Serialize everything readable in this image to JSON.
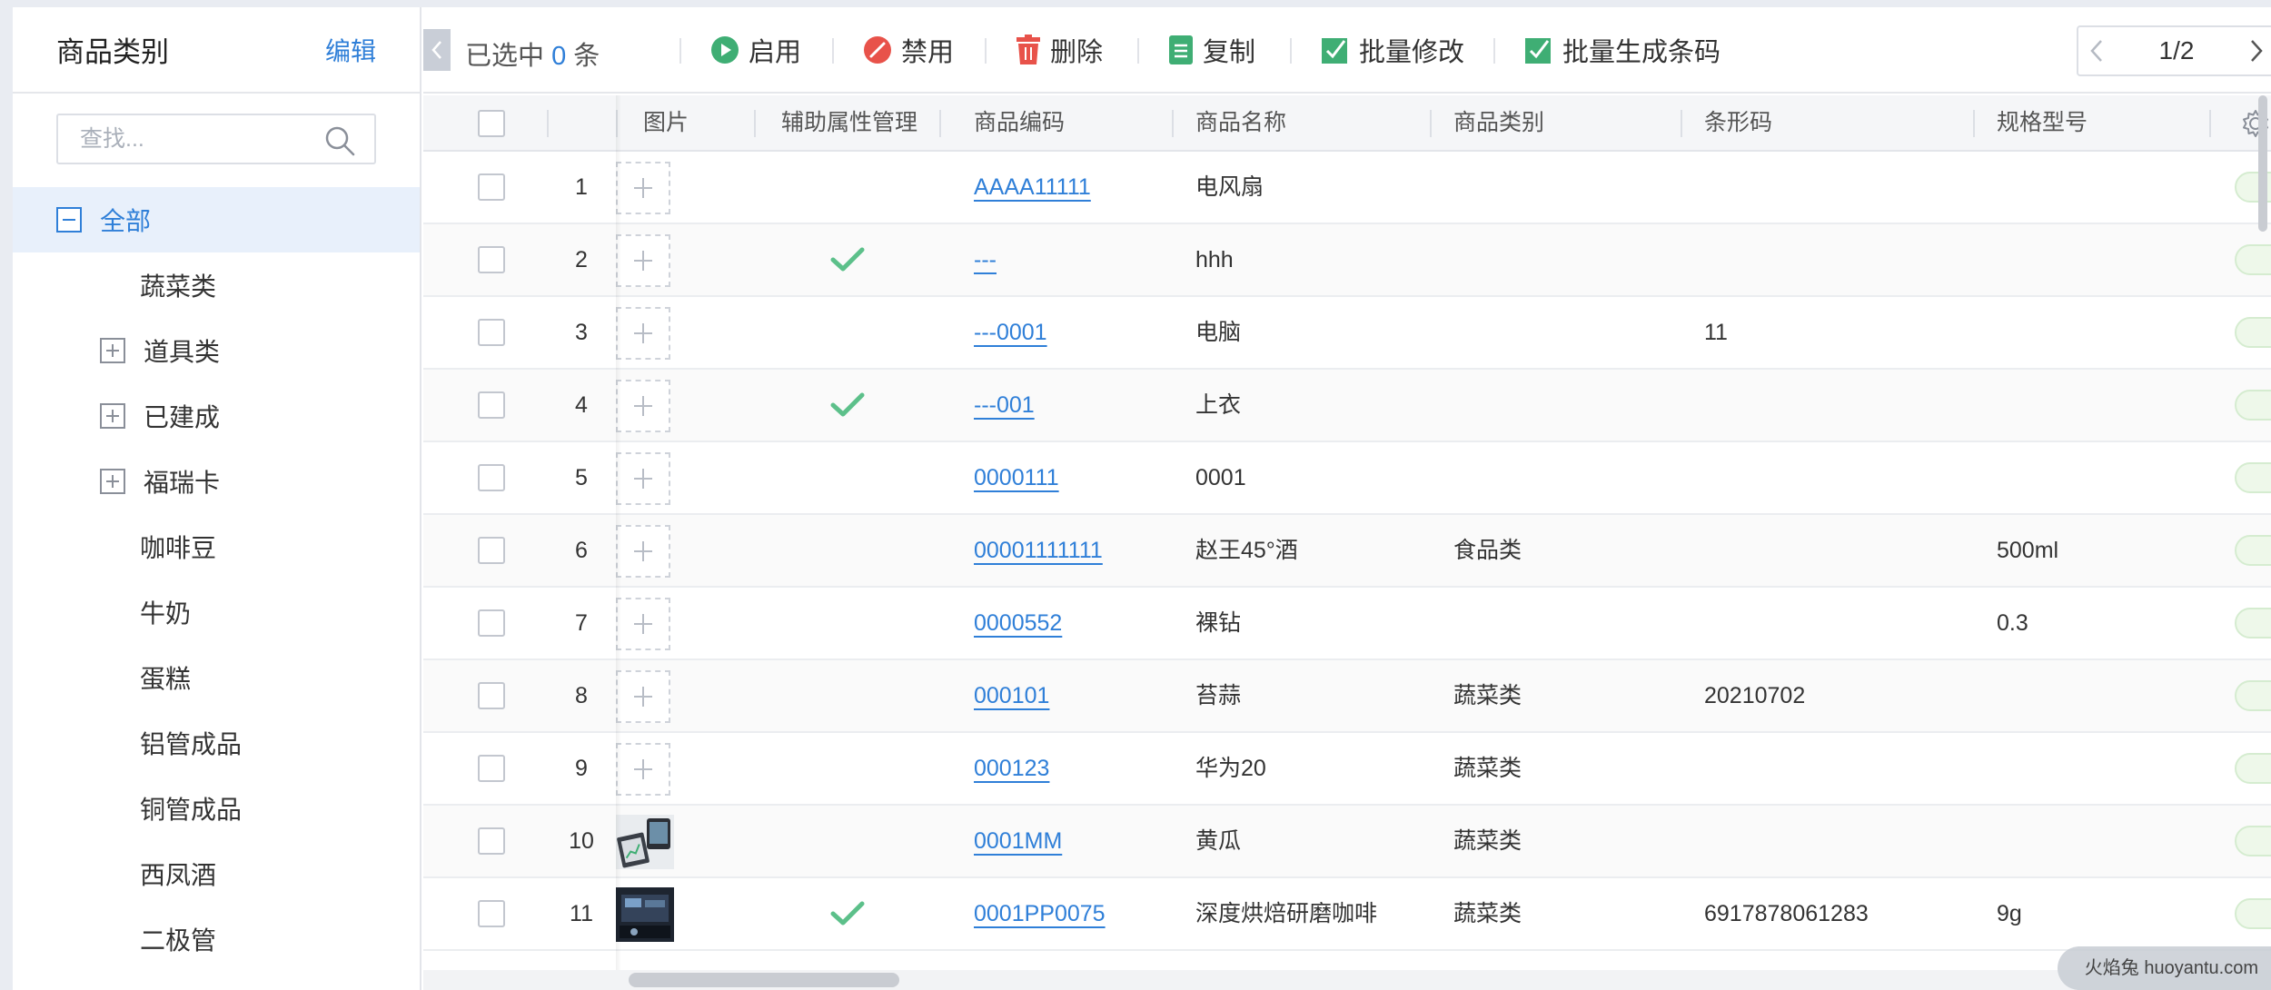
{
  "sidebar": {
    "title": "商品类别",
    "edit_label": "编辑",
    "search_placeholder": "查找...",
    "tree": [
      {
        "label": "全部",
        "level": 0,
        "toggle": "minus",
        "active": true
      },
      {
        "label": "蔬菜类",
        "level": 1,
        "toggle": "none"
      },
      {
        "label": "道具类",
        "level": 1,
        "toggle": "plus"
      },
      {
        "label": "已建成",
        "level": 1,
        "toggle": "plus"
      },
      {
        "label": "福瑞卡",
        "level": 1,
        "toggle": "plus"
      },
      {
        "label": "咖啡豆",
        "level": 1,
        "toggle": "none"
      },
      {
        "label": "牛奶",
        "level": 1,
        "toggle": "none"
      },
      {
        "label": "蛋糕",
        "level": 1,
        "toggle": "none"
      },
      {
        "label": "铝管成品",
        "level": 1,
        "toggle": "none"
      },
      {
        "label": "铜管成品",
        "level": 1,
        "toggle": "none"
      },
      {
        "label": "西凤酒",
        "level": 1,
        "toggle": "none"
      },
      {
        "label": "二极管",
        "level": 1,
        "toggle": "none"
      }
    ]
  },
  "toolbar": {
    "selected_prefix": "已选中",
    "selected_count": "0",
    "selected_suffix": "条",
    "enable_label": "启用",
    "disable_label": "禁用",
    "delete_label": "删除",
    "copy_label": "复制",
    "batch_edit_label": "批量修改",
    "batch_barcode_label": "批量生成条码",
    "pager_text": "1/2"
  },
  "table": {
    "headers": {
      "image": "图片",
      "aux_attr": "辅助属性管理",
      "code": "商品编码",
      "name": "商品名称",
      "category": "商品类别",
      "barcode": "条形码",
      "spec": "规格型号"
    },
    "rows": [
      {
        "no": "1",
        "image": "placeholder",
        "aux": false,
        "code": "AAAA11111",
        "name": "电风扇",
        "category": "",
        "barcode": "",
        "spec": ""
      },
      {
        "no": "2",
        "image": "placeholder",
        "aux": true,
        "code": "---",
        "name": "hhh",
        "category": "",
        "barcode": "",
        "spec": ""
      },
      {
        "no": "3",
        "image": "placeholder",
        "aux": false,
        "code": "---0001",
        "name": "电脑",
        "category": "",
        "barcode": "11",
        "spec": ""
      },
      {
        "no": "4",
        "image": "placeholder",
        "aux": true,
        "code": "---001",
        "name": "上衣",
        "category": "",
        "barcode": "",
        "spec": ""
      },
      {
        "no": "5",
        "image": "placeholder",
        "aux": false,
        "code": "0000111",
        "name": "0001",
        "category": "",
        "barcode": "",
        "spec": ""
      },
      {
        "no": "6",
        "image": "placeholder",
        "aux": false,
        "code": "00001111111",
        "name": "赵王45°酒",
        "category": "食品类",
        "barcode": "",
        "spec": "500ml"
      },
      {
        "no": "7",
        "image": "placeholder",
        "aux": false,
        "code": "0000552",
        "name": "裸钻",
        "category": "",
        "barcode": "",
        "spec": "0.3"
      },
      {
        "no": "8",
        "image": "placeholder",
        "aux": false,
        "code": "000101",
        "name": "苔蒜",
        "category": "蔬菜类",
        "barcode": "20210702",
        "spec": ""
      },
      {
        "no": "9",
        "image": "placeholder",
        "aux": false,
        "code": "000123",
        "name": "华为20",
        "category": "蔬菜类",
        "barcode": "",
        "spec": ""
      },
      {
        "no": "10",
        "image": "photo-devices",
        "aux": false,
        "code": "0001MM",
        "name": "黄瓜",
        "category": "蔬菜类",
        "barcode": "",
        "spec": ""
      },
      {
        "no": "11",
        "image": "photo-dark",
        "aux": true,
        "code": "0001PP0075",
        "name": "深度烘焙研磨咖啡",
        "category": "蔬菜类",
        "barcode": "6917878061283",
        "spec": "9g"
      }
    ]
  },
  "watermark": "火焰兔 huoyantu.com",
  "colors": {
    "accent": "#2f7fd8",
    "check": "#5cc08a",
    "enable": "#3fae74",
    "disable": "#e8524a",
    "delete": "#e8524a"
  },
  "icons": {
    "search": "search-icon",
    "enable": "enable-icon",
    "disable": "disable-icon",
    "delete": "trash-icon",
    "copy": "copy-icon",
    "batch_edit": "checkbox-checked-icon",
    "settings": "gear-icon"
  }
}
